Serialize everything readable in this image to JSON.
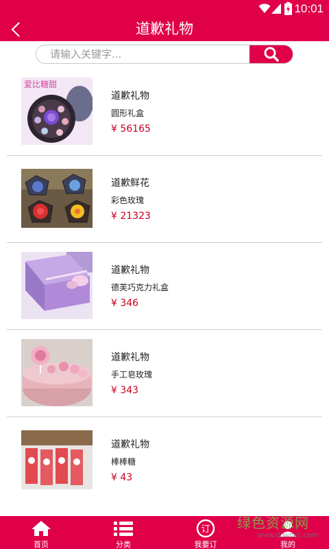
{
  "status": {
    "time": "10:01"
  },
  "header": {
    "title": "道歉礼物"
  },
  "search": {
    "placeholder": "请输入关键字..."
  },
  "products": [
    {
      "name": "道歉礼物",
      "desc": "圆形礼盒",
      "price": "¥ 56165"
    },
    {
      "name": "道歉鲜花",
      "desc": "彩色玫瑰",
      "price": "¥ 21323"
    },
    {
      "name": "道歉礼物",
      "desc": "德芙巧克力礼盒",
      "price": "¥ 346"
    },
    {
      "name": "道歉礼物",
      "desc": "手工皂玫瑰",
      "price": "¥ 343"
    },
    {
      "name": "道歉礼物",
      "desc": "棒棒糖",
      "price": "¥ 43"
    }
  ],
  "tabs": [
    {
      "label": "首页",
      "icon": "home-icon"
    },
    {
      "label": "分类",
      "icon": "list-icon"
    },
    {
      "label": "我要订",
      "icon": "order-icon"
    },
    {
      "label": "我的",
      "icon": "user-icon"
    }
  ],
  "thumb_labels": {
    "product1": "爱比糖甜"
  },
  "watermark": {
    "cn": "绿色资源网",
    "en": "www.downcc.com"
  },
  "colors": {
    "brand": "#e0004a",
    "price": "#c8001e",
    "divider": "#cfcfcf"
  }
}
